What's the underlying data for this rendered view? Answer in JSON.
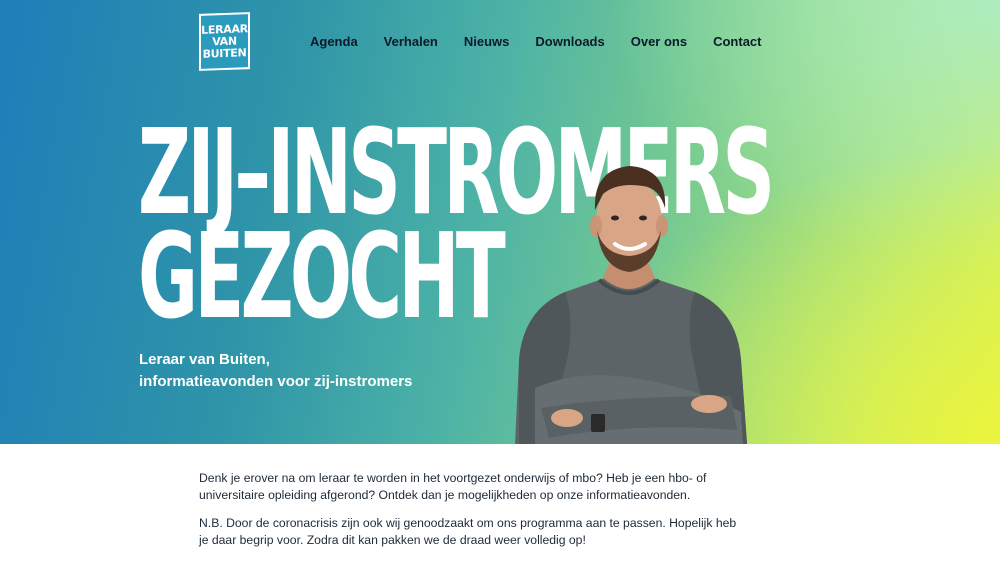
{
  "logo": {
    "lines": [
      "LERAAR",
      "VAN",
      "BUITEN"
    ]
  },
  "nav": {
    "items": [
      {
        "label": "Agenda"
      },
      {
        "label": "Verhalen"
      },
      {
        "label": "Nieuws"
      },
      {
        "label": "Downloads"
      },
      {
        "label": "Over ons"
      },
      {
        "label": "Contact"
      }
    ]
  },
  "hero": {
    "headline_line1": "ZIJ–INSTROMERS",
    "headline_line2": "GEZOCHT",
    "subtitle_line1": "Leraar van Buiten,",
    "subtitle_line2": "informatieavonden voor zij-instromers",
    "colors": {
      "gradient_start": "#1f7db9",
      "gradient_mid": "#7ccd8e",
      "gradient_end": "#ebf43c"
    }
  },
  "content": {
    "paragraph1": "Denk je erover na om leraar te worden in het voortgezet onderwijs of mbo? Heb je een hbo- of universitaire opleiding afgerond? Ontdek dan je mogelijkheden op onze informatieavonden.",
    "paragraph2": "N.B. Door de coronacrisis zijn ook wij genoodzaakt om ons programma aan te passen. Hopelijk heb je daar begrip voor. Zodra dit kan pakken we de draad weer volledig op!"
  }
}
